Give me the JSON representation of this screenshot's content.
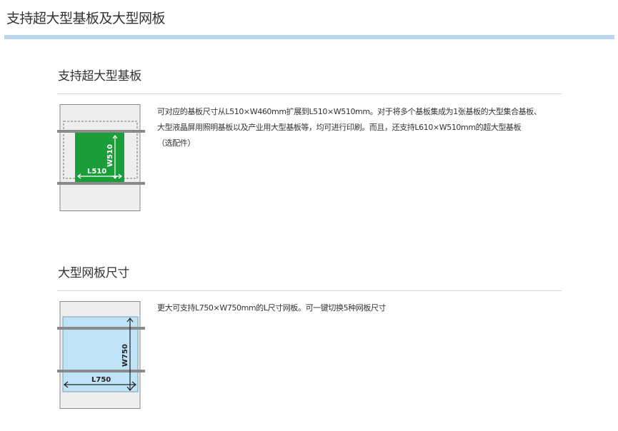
{
  "page": {
    "title": "支持超大型基板及大型网板"
  },
  "sections": [
    {
      "title": "支持超大型基板",
      "description_lines": [
        "可对应的基板尺寸从L510×W460mm扩展到L510×W510mm。对于将多个基板集成为1张基板的大型集合基板、",
        "大型液晶屏用照明基板以及产业用大型基板等，均可进行印刷。而且，还支持L610×W510mm的超大型基板",
        "（选配件）"
      ],
      "diagram": {
        "length_label": "L510",
        "width_label": "W510",
        "fill_color": "#1a9e3a"
      }
    },
    {
      "title": "大型网板尺寸",
      "description_lines": [
        "更大可支持L750×W750mm的L尺寸网板。可一键切换5种网板尺寸"
      ],
      "diagram": {
        "length_label": "L750",
        "width_label": "W750",
        "fill_color": "#bfe3f7"
      }
    }
  ]
}
